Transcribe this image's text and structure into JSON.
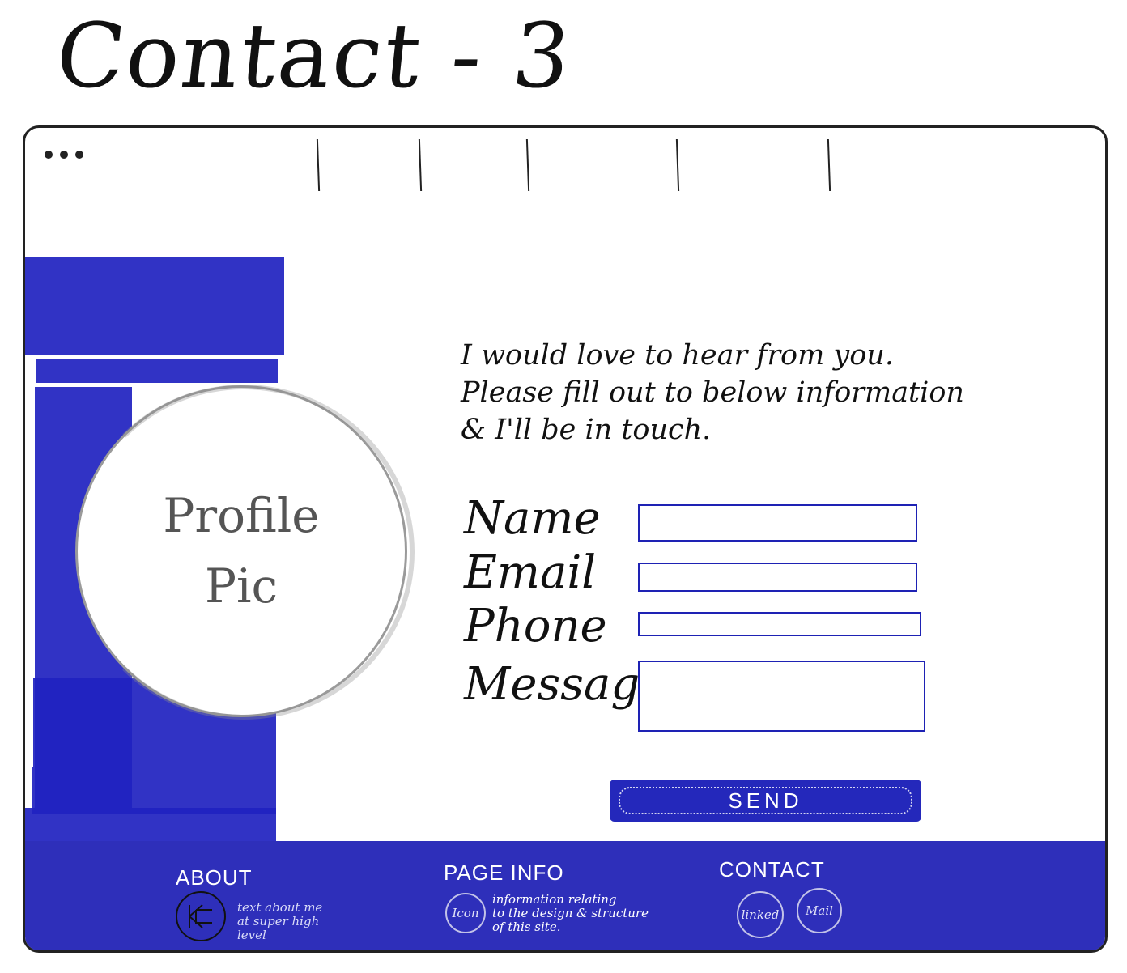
{
  "page": {
    "title": "Contact - 3"
  },
  "nav": {
    "items": [
      "",
      "",
      "",
      "",
      ""
    ]
  },
  "profile": {
    "line1": "Profile",
    "line2": "Pic"
  },
  "intro": {
    "line1": "I would love to hear from you.",
    "line2": "Please fill out to below information",
    "line3": "& I'll be in touch."
  },
  "form": {
    "name_label": "Name",
    "email_label": "Email",
    "phone_label": "Phone",
    "message_label": "Message",
    "name_value": "",
    "email_value": "",
    "phone_value": "",
    "message_value": "",
    "send_label": "SEND"
  },
  "footer": {
    "about": {
      "heading": "ABOUT",
      "text_line1": "text about me",
      "text_line2": "at super high",
      "text_line3": "level"
    },
    "page_info": {
      "heading": "PAGE INFO",
      "icon_label": "Icon",
      "text_line1": "information relating",
      "text_line2": "to the design & structure",
      "text_line3": "of this site."
    },
    "contact": {
      "heading": "CONTACT",
      "linked_label": "linked",
      "mail_label": "Mail"
    }
  },
  "colors": {
    "accent": "#2428bb",
    "outline": "#222222",
    "field_border": "#1e22b4"
  }
}
